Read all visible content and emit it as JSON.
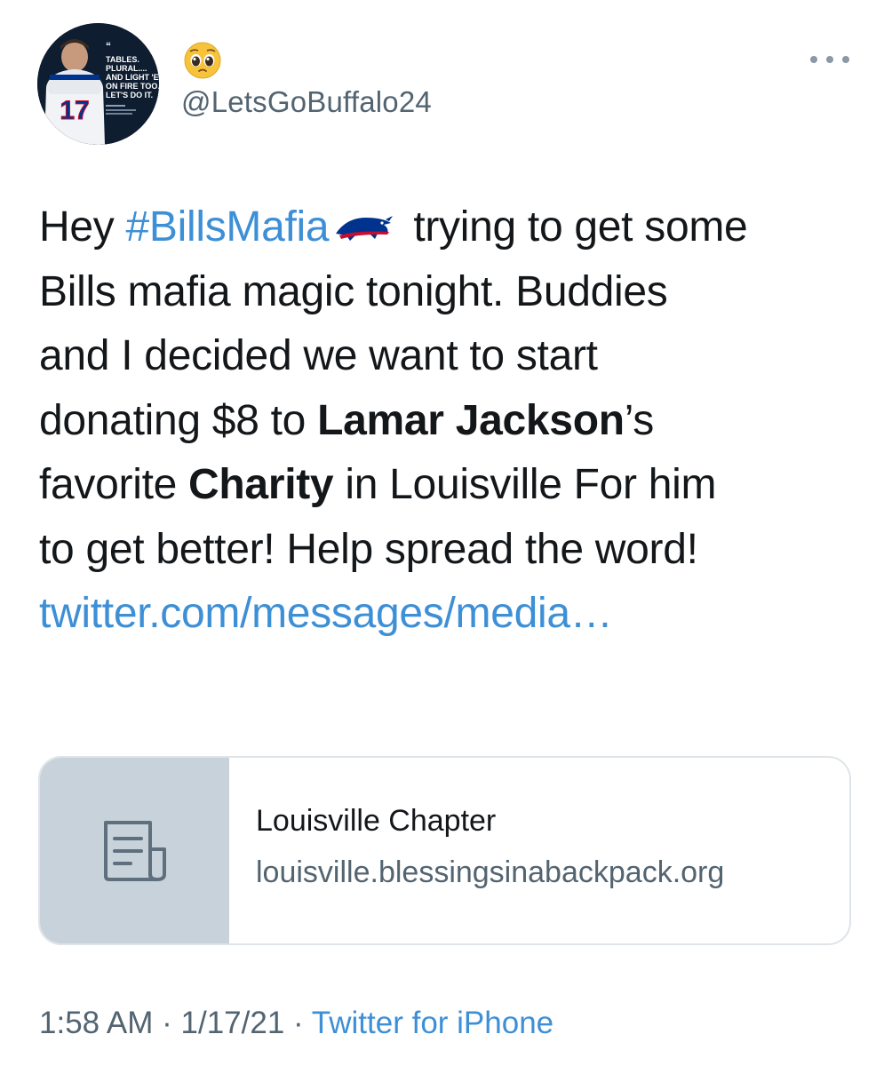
{
  "author": {
    "display_name_emoji": "🥺",
    "handle": "@LetsGoBuffalo24",
    "avatar_caption": [
      "TABLES.",
      "PLURAL....",
      "AND LIGHT 'EM",
      "ON FIRE TOO.",
      "LET'S DO IT."
    ],
    "avatar_jersey_number": "17"
  },
  "tweet": {
    "line1_prefix": "Hey ",
    "hashtag": "#BillsMafia",
    "line1_suffix": " trying to get some",
    "line2": "Bills mafia magic tonight. Buddies",
    "line3": "and I decided we want to start",
    "line4_prefix": "donating $8 to ",
    "line4_bold": "Lamar Jackson",
    "line4_suffix": "’s",
    "line5_prefix": "favorite ",
    "line5_bold": "Charity",
    "line5_suffix": " in Louisville For him",
    "line6": "to get better! Help spread the word!",
    "link": "twitter.com/messages/media…"
  },
  "card": {
    "icon": "document-icon",
    "title": "Louisville Chapter",
    "domain": "louisville.blessingsinabackpack.org"
  },
  "meta": {
    "time": "1:58 AM",
    "separator": " · ",
    "date": "1/17/21",
    "source": "Twitter for iPhone"
  },
  "colors": {
    "link": "#3d8fd6",
    "secondary_text": "#536471",
    "card_thumb": "#c8d2da",
    "bills_blue": "#00338d",
    "bills_red": "#c60c30"
  },
  "icons": {
    "more": "more-horizontal-icon",
    "team_logo": "buffalo-bills-logo-icon"
  }
}
